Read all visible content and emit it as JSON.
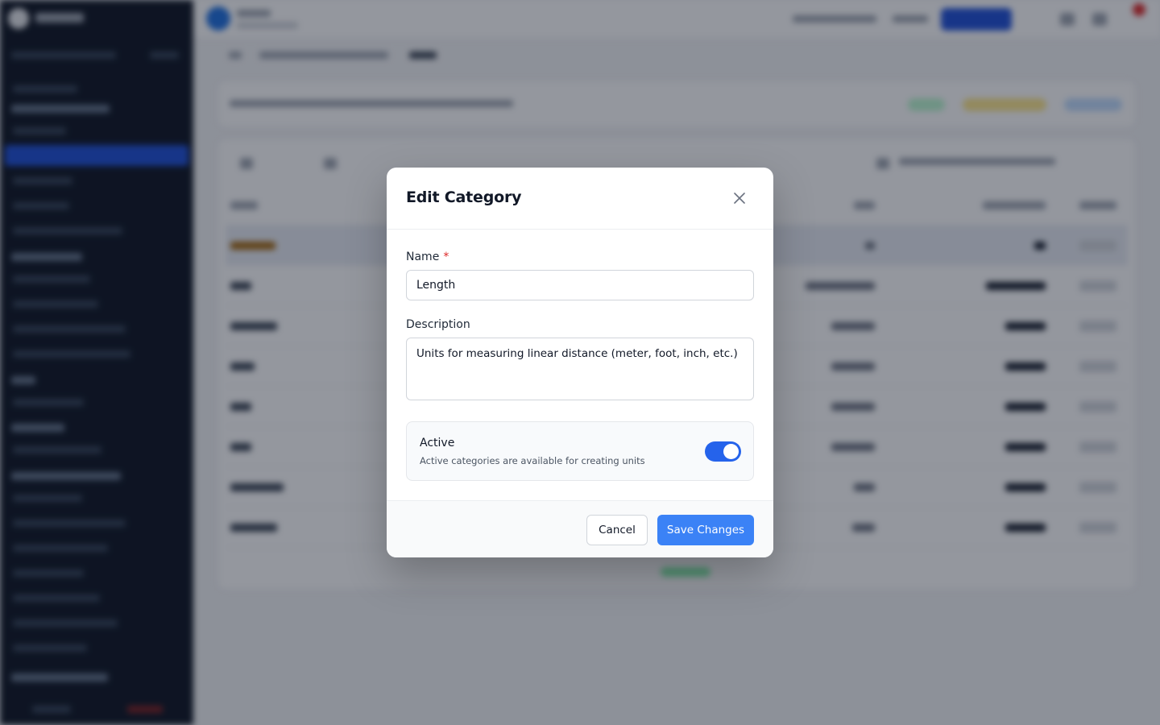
{
  "modal": {
    "title": "Edit Category",
    "close_icon": "close-icon",
    "name_field": {
      "label": "Name",
      "required_marker": "*",
      "value": "Length"
    },
    "description_field": {
      "label": "Description",
      "value": "Units for measuring linear distance (meter, foot, inch, etc.)"
    },
    "active_toggle": {
      "label": "Active",
      "description": "Active categories are available for creating units",
      "checked": true
    },
    "footer": {
      "cancel_label": "Cancel",
      "save_label": "Save Changes"
    }
  },
  "colors": {
    "accent": "#3b82f6",
    "toggle_on": "#2563eb",
    "required": "#dc2626",
    "sidebar": "#0b1220"
  }
}
